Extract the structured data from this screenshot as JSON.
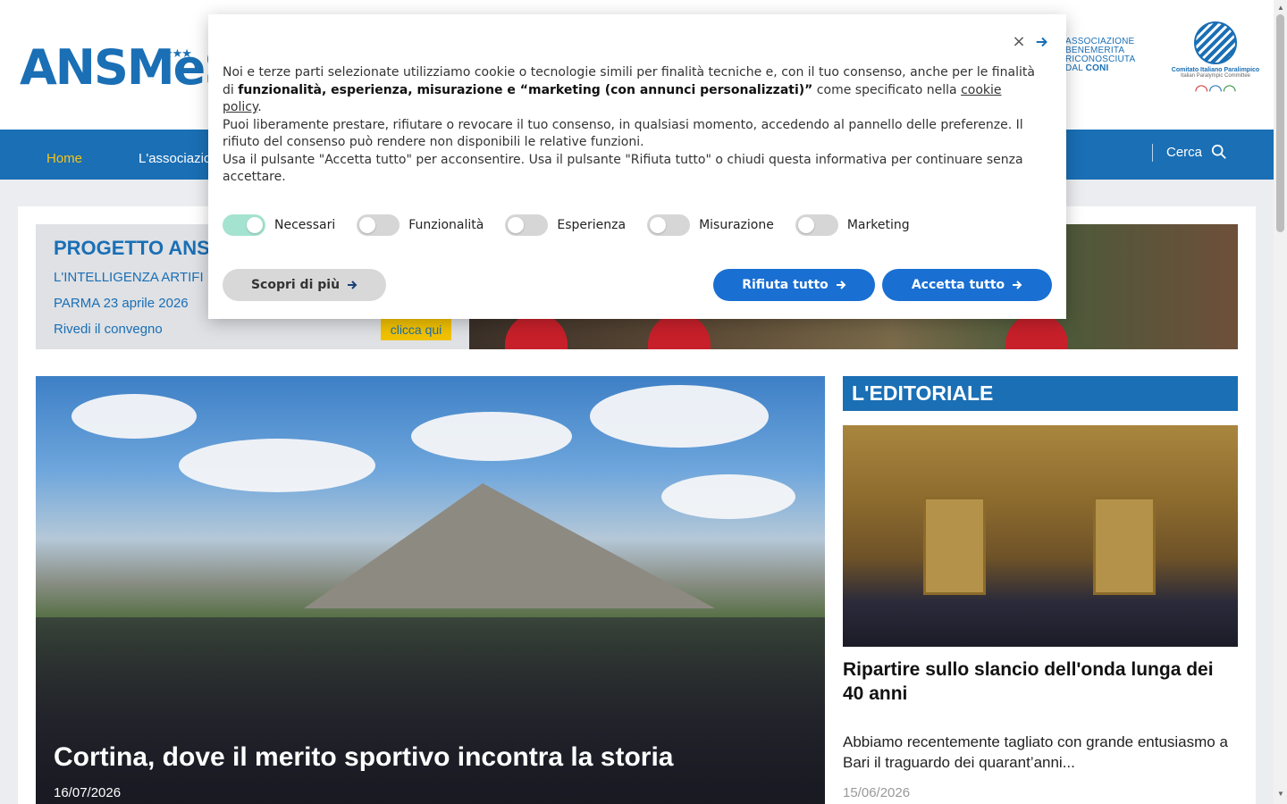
{
  "header": {
    "logo": "ANSMeS",
    "assoc_logo_lines": [
      "ASSOCIAZIONE",
      "BENEMERITA",
      "RICONOSCIUTA"
    ],
    "assoc_logo_last_prefix": "DAL ",
    "assoc_logo_last_brand": "CONI",
    "cip_title": "Comitato Italiano Paralimpico",
    "cip_subtitle": "Italian Paralympic Committee"
  },
  "nav": {
    "items": [
      {
        "label": "Home",
        "active": true
      },
      {
        "label": "L'associazion",
        "active": false
      }
    ],
    "search_label": "Cerca"
  },
  "promo": {
    "title": "PROGETTO ANSM",
    "line1": "L'INTELLIGENZA ARTIFI",
    "line2": "PARMA 23 aprile 2026",
    "line3": "Rivedi il convegno",
    "cta": "clicca qui"
  },
  "hero": {
    "title": "Cortina, dove il merito sportivo incontra la storia",
    "date": "16/07/2026"
  },
  "editorial": {
    "heading": "L'EDITORIALE",
    "title": "Ripartire sullo slancio dell'onda lunga dei 40 anni",
    "excerpt": "Abbiamo recentemente tagliato con grande entusiasmo a Bari il traguardo dei quarant’anni...",
    "date": "15/06/2026"
  },
  "cookie": {
    "p1_start": "Noi e terze parti selezionate utilizziamo cookie o tecnologie simili per finalità tecniche e, con il tuo consenso, anche per le finalità di ",
    "p1_bold": "funzionalità, esperienza, misurazione e “marketing (con annunci personalizzati)”",
    "p1_mid": " come specificato nella ",
    "p1_link": "cookie policy",
    "p1_end": ".",
    "p2": "Puoi liberamente prestare, rifiutare o revocare il tuo consenso, in qualsiasi momento, accedendo al pannello delle preferenze. Il rifiuto del consenso può rendere non disponibili le relative funzioni.",
    "p3": "Usa il pulsante \"Accetta tutto\" per acconsentire. Usa il pulsante \"Rifiuta tutto\" o chiudi questa informativa per continuare senza accettare.",
    "toggles": [
      {
        "label": "Necessari",
        "on": true
      },
      {
        "label": "Funzionalità",
        "on": false
      },
      {
        "label": "Esperienza",
        "on": false
      },
      {
        "label": "Misurazione",
        "on": false
      },
      {
        "label": "Marketing",
        "on": false
      }
    ],
    "more_button": "Scopri di più",
    "reject_button": "Rifiuta tutto",
    "accept_button": "Accetta tutto"
  },
  "colors": {
    "brand_blue": "#1a6fb5",
    "nav_active": "#f5c518",
    "button_blue": "#1a6fd2",
    "toggle_on": "#a4e3d0",
    "cta_yellow": "#f2c200"
  }
}
